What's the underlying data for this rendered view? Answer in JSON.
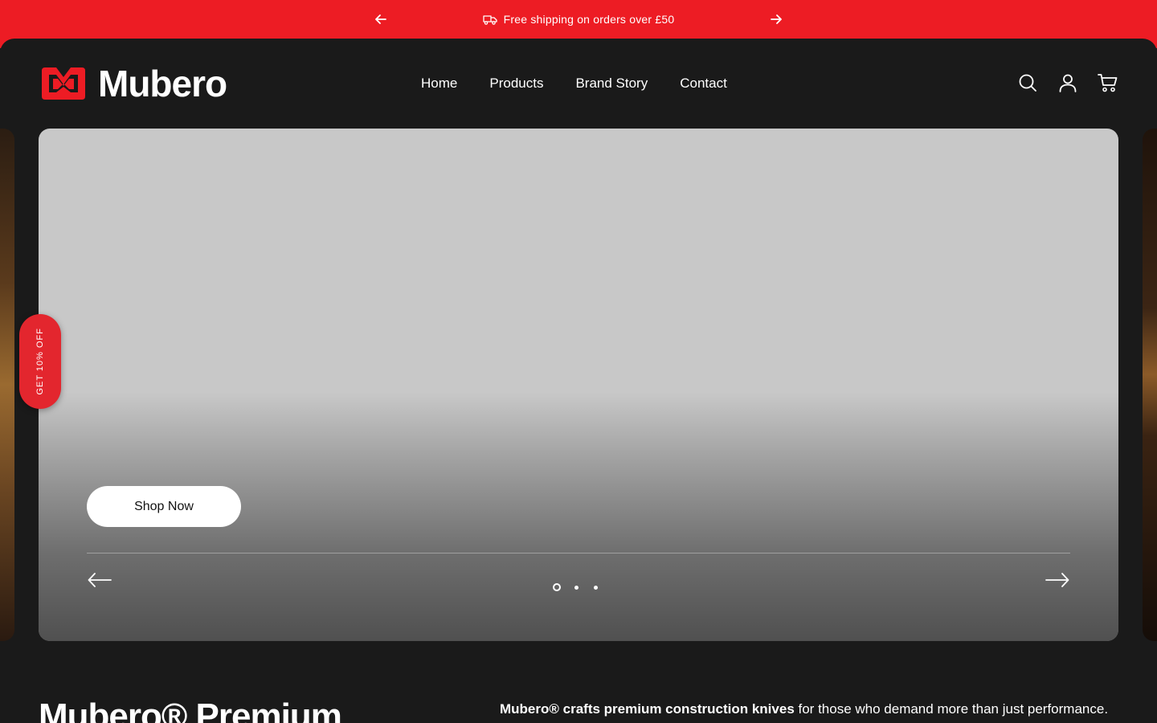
{
  "announcement": {
    "text": "Free shipping on orders over £50",
    "prev_icon": "arrow-left-icon",
    "next_icon": "arrow-right-icon",
    "leading_icon": "truck-icon",
    "background": "#ed1c24"
  },
  "header": {
    "logo_text": "Mubero",
    "logo_icon": "mubero-m-logo",
    "nav": [
      {
        "label": "Home"
      },
      {
        "label": "Products"
      },
      {
        "label": "Brand Story"
      },
      {
        "label": "Contact"
      }
    ],
    "icons": [
      "search-icon",
      "account-icon",
      "cart-icon"
    ]
  },
  "hero": {
    "cta_label": "Shop Now",
    "slides_count": 3,
    "active_slide": 1,
    "prev_icon": "arrow-left-icon",
    "next_icon": "arrow-right-icon"
  },
  "discount_tab": {
    "label": "GET 10% OFF"
  },
  "intro": {
    "title": "Mubero® Premium",
    "lead_bold": "Mubero® crafts premium construction knives",
    "lead_rest": " for those who demand more than just performance."
  },
  "colors": {
    "brand_red": "#ed1c24",
    "background": "#1a1a1a",
    "hero_placeholder": "#c8c8c8"
  }
}
